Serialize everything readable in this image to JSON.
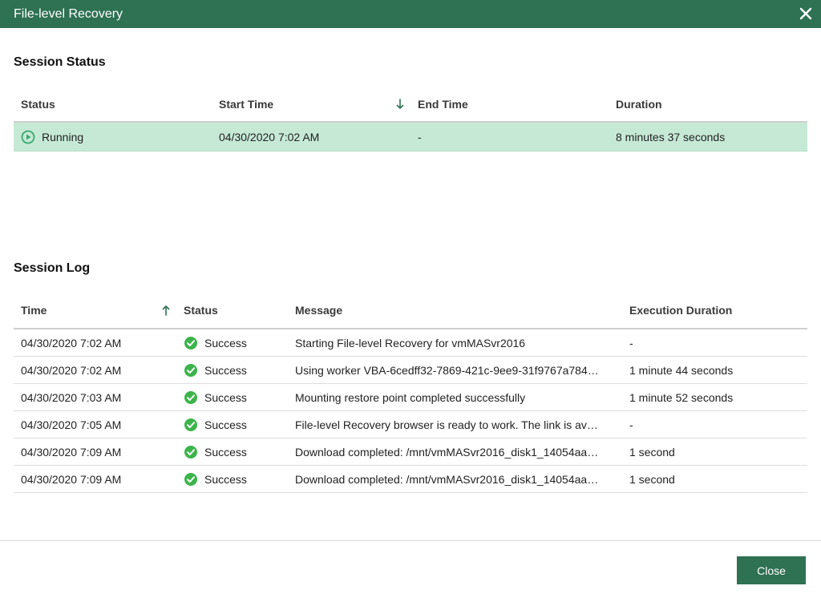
{
  "window": {
    "title": "File-level Recovery"
  },
  "session_status": {
    "title": "Session Status",
    "columns": {
      "status": "Status",
      "start_time": "Start Time",
      "end_time": "End Time",
      "duration": "Duration"
    },
    "row": {
      "status": "Running",
      "start_time": "04/30/2020 7:02 AM",
      "end_time": "-",
      "duration": "8 minutes 37 seconds"
    }
  },
  "session_log": {
    "title": "Session Log",
    "columns": {
      "time": "Time",
      "status": "Status",
      "message": "Message",
      "execution_duration": "Execution Duration"
    },
    "rows": [
      {
        "time": "04/30/2020 7:02 AM",
        "status": "Success",
        "message": "Starting File-level Recovery for vmMASvr2016",
        "duration": "-"
      },
      {
        "time": "04/30/2020 7:02 AM",
        "status": "Success",
        "message": "Using worker VBA-6cedff32-7869-421c-9ee9-31f9767a784…",
        "duration": "1 minute 44 seconds"
      },
      {
        "time": "04/30/2020 7:03 AM",
        "status": "Success",
        "message": "Mounting restore point completed successfully",
        "duration": "1 minute 52 seconds"
      },
      {
        "time": "04/30/2020 7:05 AM",
        "status": "Success",
        "message": "File-level Recovery browser is ready to work. The link is av…",
        "duration": "-"
      },
      {
        "time": "04/30/2020 7:09 AM",
        "status": "Success",
        "message": "Download completed: /mnt/vmMASvr2016_disk1_14054aa…",
        "duration": "1 second"
      },
      {
        "time": "04/30/2020 7:09 AM",
        "status": "Success",
        "message": "Download completed: /mnt/vmMASvr2016_disk1_14054aa…",
        "duration": "1 second"
      }
    ]
  },
  "footer": {
    "close_label": "Close"
  },
  "colors": {
    "brand": "#2e7153",
    "selected_row": "#c6e9d6",
    "success": "#3cb44b",
    "running": "#3aa76d"
  },
  "icons": {
    "close": "close-icon",
    "running": "running-play-icon",
    "success": "success-check-icon",
    "sort_down": "sort-descending-icon",
    "sort_up": "sort-ascending-icon"
  }
}
